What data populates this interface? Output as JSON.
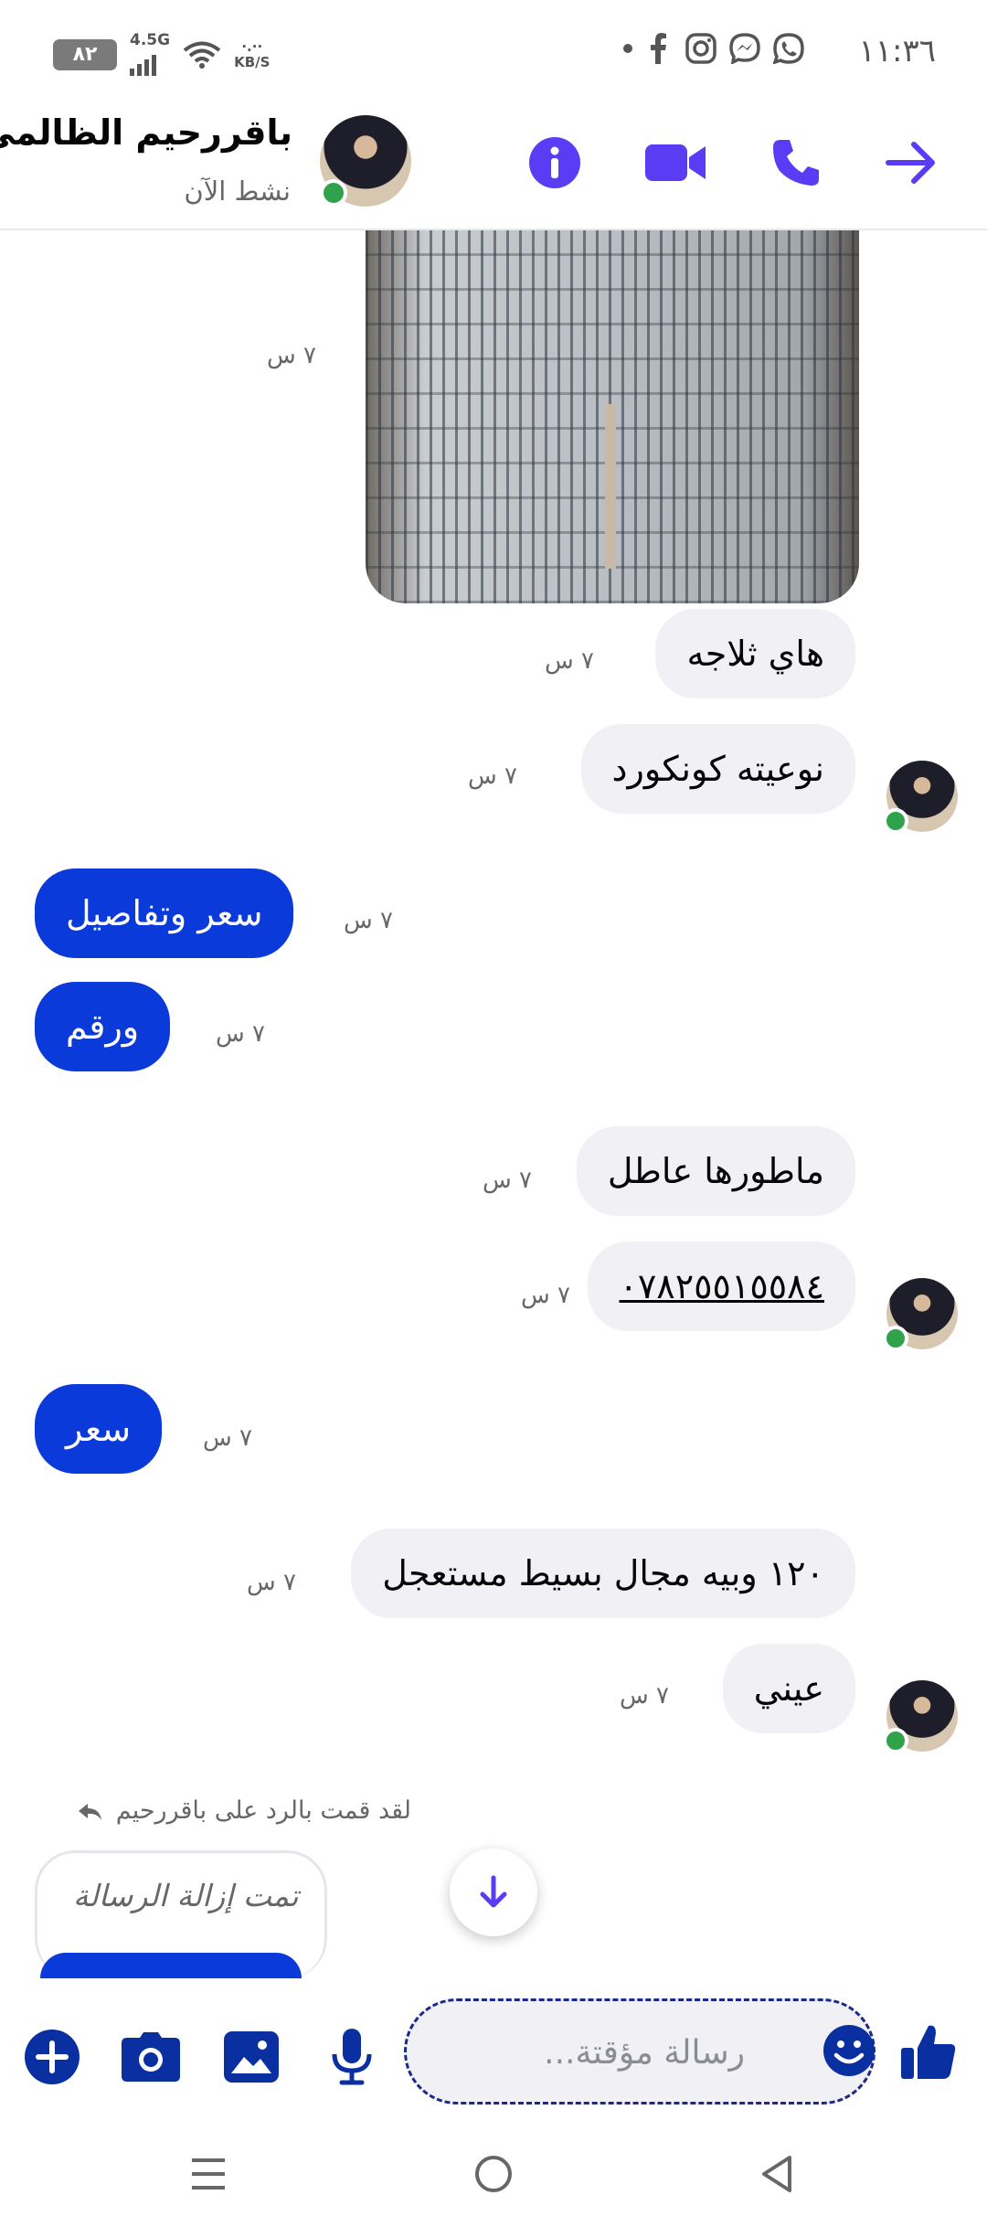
{
  "status_bar": {
    "time": "١١:٣٦",
    "battery": "٨٢",
    "network": "4.5G",
    "speed_top": "·.··",
    "speed_unit": "KB/S"
  },
  "header": {
    "contact_name": "باقررحيم الظالمي",
    "status": "نشط الآن",
    "accent_color": "#5b3cf5"
  },
  "messages": [
    {
      "text": "",
      "time": "٧ س",
      "side": "incoming",
      "type": "photo"
    },
    {
      "text": "هاي ثلاجه",
      "time": "٧ س",
      "side": "incoming"
    },
    {
      "text": "نوعيته كونكورد",
      "time": "٧ س",
      "side": "incoming"
    },
    {
      "text": "سعر وتفاصيل",
      "time": "٧ س",
      "side": "outgoing"
    },
    {
      "text": "ورقم",
      "time": "٧ س",
      "side": "outgoing"
    },
    {
      "text": "ماطورها عاطل",
      "time": "٧ س",
      "side": "incoming"
    },
    {
      "text": "٠٧٨٢٥٥١٥٥٨٤",
      "time": "٧ س",
      "side": "incoming"
    },
    {
      "text": "سعر",
      "time": "٧ س",
      "side": "outgoing"
    },
    {
      "text": "١٢٠ وبيه مجال بسيط مستعجل",
      "time": "٧ س",
      "side": "incoming"
    },
    {
      "text": "عيني",
      "time": "٧ س",
      "side": "incoming"
    }
  ],
  "reply": {
    "note": "لقد قمت بالرد على باقررحيم",
    "removed_text": "تمت إزالة الرسالة"
  },
  "composer": {
    "placeholder": "رسالة مؤقتة..."
  },
  "colors": {
    "outgoing_bubble": "#0a3ad9",
    "incoming_bubble": "#f0f0f5",
    "online": "#31a24c",
    "composer_icons": "#0a2fa0"
  }
}
